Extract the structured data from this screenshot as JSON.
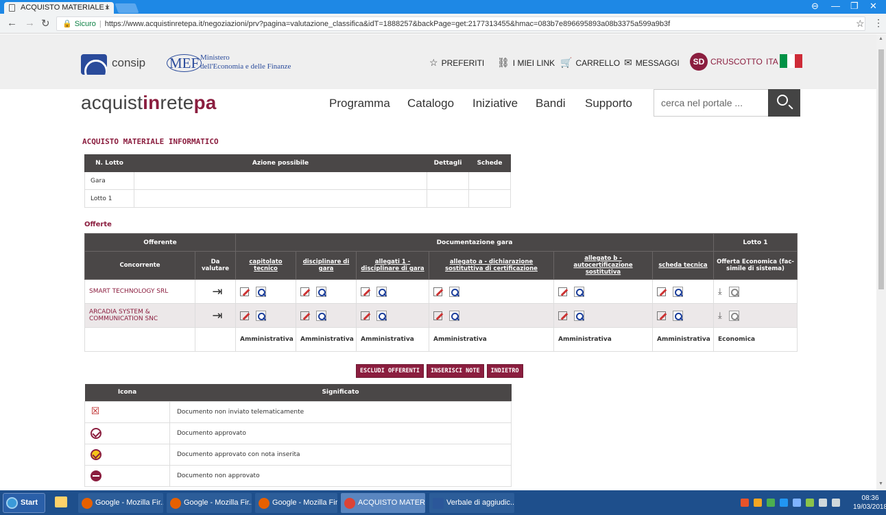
{
  "browser": {
    "tab_title": "ACQUISTO MATERIALE I",
    "tab_close": "×",
    "secure_label": "Sicuro",
    "url": "https://www.acquistinretepa.it/negoziazioni/prv?pagina=valutazione_classifica&idT=1888257&backPage=get:2177313455&hmac=083b7e896695893a08b3375a599a9b3f",
    "window_controls": [
      "⊖",
      "—",
      "❐",
      "✕"
    ]
  },
  "header": {
    "consip": "consip",
    "mef": "MEF",
    "mef_line1": "Ministero",
    "mef_line2": "dell'Economia e delle Finanze",
    "links": [
      {
        "icon": "☆",
        "label": "PREFERITI"
      },
      {
        "icon": "⛓",
        "label": "I MIEI LINK"
      },
      {
        "icon": "🛒",
        "label": "CARRELLO"
      },
      {
        "icon": "✉",
        "label": "MESSAGGI"
      }
    ],
    "user_initials": "SD",
    "cruscotto": "CRUSCOTTO",
    "language": "ITA",
    "flag_colors": [
      "#009246",
      "#ffffff",
      "#ce2b37"
    ]
  },
  "brand": {
    "part1": "acquist",
    "part2": "in",
    "part3": "rete",
    "part4": "pa"
  },
  "nav": [
    "Programma",
    "Catalogo",
    "Iniziative",
    "Bandi",
    "Supporto"
  ],
  "search": {
    "placeholder": "cerca nel portale ..."
  },
  "page_title": "ACQUISTO MATERIALE INFORMATICO",
  "lotti_table": {
    "headers": [
      "N. Lotto",
      "Azione possibile",
      "Dettagli",
      "Schede"
    ],
    "rows": [
      [
        "Gara",
        "",
        "",
        ""
      ],
      [
        "Lotto 1",
        "",
        "",
        ""
      ]
    ]
  },
  "offerte": {
    "title": "Offerte",
    "group_headers": [
      "Offerente",
      "Documentazione gara",
      "Lotto 1"
    ],
    "columns": [
      "Concorrente",
      "Da valutare",
      "capitolato tecnico",
      "disciplinare di gara",
      "allegati 1 - disciplinare di gara",
      "allegato a - dichiarazione sostituttiva di certificazione",
      "allegato b - autocertificazione sostitutiva",
      "scheda tecnica",
      "Offerta Economica (fac-simile di sistema)"
    ],
    "rows": [
      {
        "name": "SMART TECHNOLOGY SRL"
      },
      {
        "name": "ARCADIA SYSTEM & COMMUNICATION SNC"
      }
    ],
    "categories": [
      "Amministrativa",
      "Amministrativa",
      "Amministrativa",
      "Amministrativa",
      "Amministrativa",
      "Amministrativa",
      "Economica"
    ]
  },
  "buttons": {
    "escludi": "ESCLUDI OFFERENTI",
    "note": "INSERISCI NOTE",
    "indietro": "INDIETRO"
  },
  "legend": {
    "headers": [
      "Icona",
      "Significato"
    ],
    "rows": [
      {
        "icon": "document-not-sent-icon",
        "text": "Documento non inviato telematicamente"
      },
      {
        "icon": "approved-icon",
        "text": "Documento approvato"
      },
      {
        "icon": "approved-with-note-icon",
        "text": "Documento approvato con nota inserita"
      },
      {
        "icon": "not-approved-icon",
        "text": "Documento non approvato"
      }
    ]
  },
  "taskbar": {
    "start": "Start",
    "items": [
      {
        "label": "Google - Mozilla Fir...",
        "color": "#e66000"
      },
      {
        "label": "Google - Mozilla Fir...",
        "color": "#e66000"
      },
      {
        "label": "Google - Mozilla Fir...",
        "color": "#e66000"
      },
      {
        "label": "ACQUISTO MATERI...",
        "color": "#db4437"
      },
      {
        "label": "Verbale di aggiudic...",
        "color": "#2b579a"
      }
    ],
    "time": "08:36",
    "date": "19/03/2018"
  }
}
